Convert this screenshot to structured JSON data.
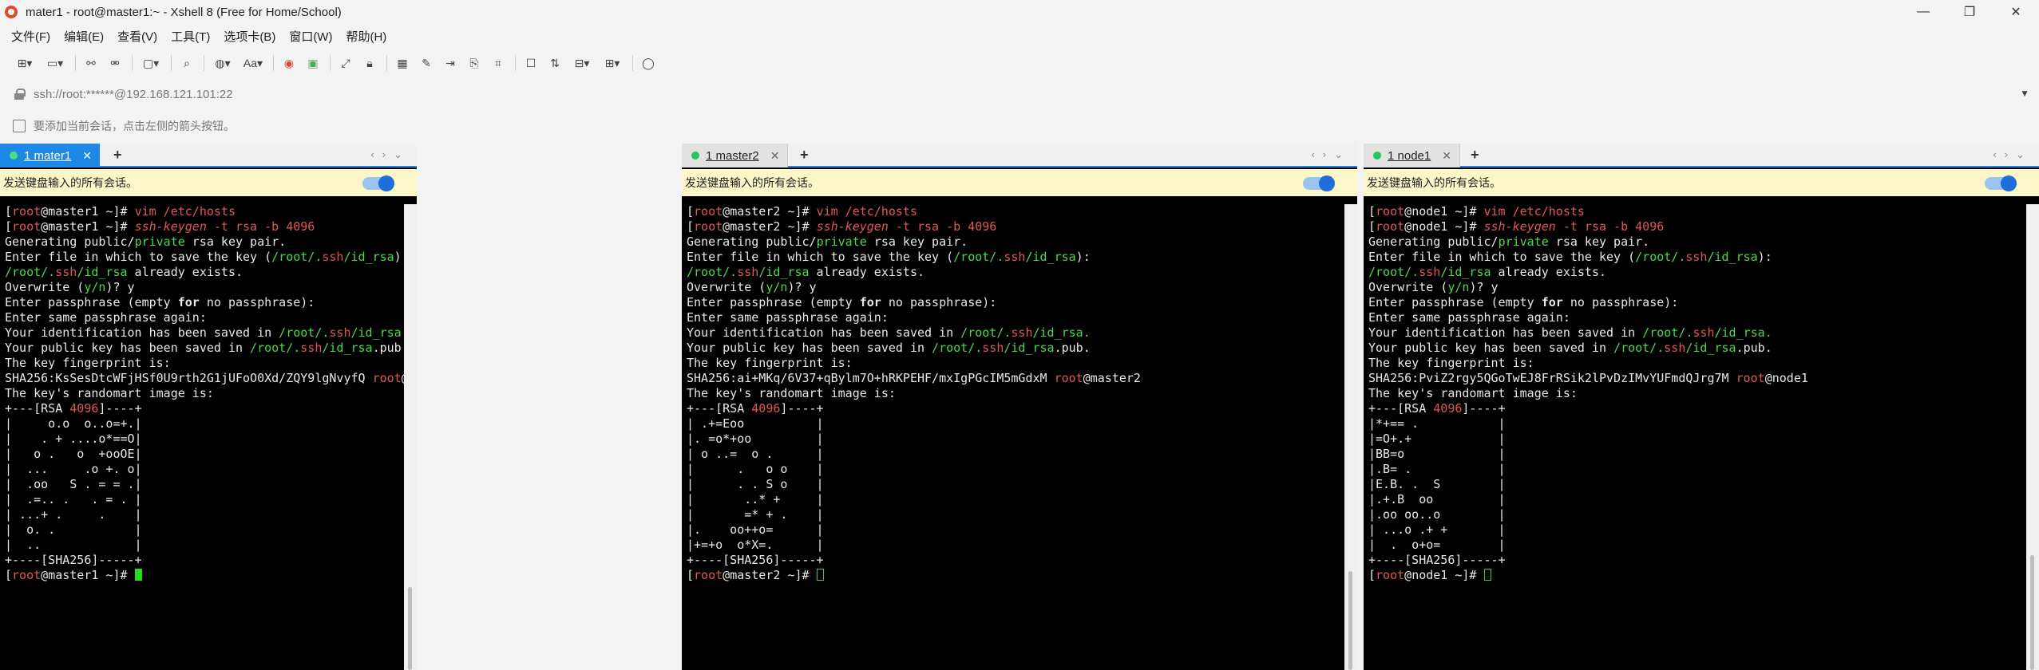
{
  "window": {
    "title": "mater1 - root@master1:~ - Xshell 8 (Free for Home/School)",
    "controls": [
      "—",
      "❐",
      "✕"
    ]
  },
  "menu": [
    "文件(F)",
    "编辑(E)",
    "查看(V)",
    "工具(T)",
    "选项卡(B)",
    "窗口(W)",
    "帮助(H)"
  ],
  "toolbar_icons": [
    "new-session-icon",
    "open-folder-icon",
    "connect-icon",
    "disconnect-icon",
    "new-tab-icon",
    "find-icon",
    "globe-icon",
    "font-icon",
    "xshell-icon",
    "xftp-icon",
    "fullscreen-icon",
    "lock-icon",
    "highlight-icon",
    "script-icon",
    "record-icon",
    "compose-icon",
    "compose-bar-icon",
    "log-icon",
    "transfer-icon",
    "layout-icon",
    "chat-icon"
  ],
  "address": {
    "value": "ssh://root:******@192.168.121.101:22"
  },
  "hint": {
    "text": "要添加当前会话，点击左侧的箭头按钮。"
  },
  "send_bar_text": "发送键盘输入的所有会话。",
  "panes": [
    {
      "tab_label": "1 mater1",
      "host": "master1",
      "fingerprint": "KsSesDtcWFjHSf0U9rth2G1jUFoO0Xd/ZQY9lgNvyfQ",
      "randomart": [
        "|     o.o  o..o=+.|",
        "|    . + ....o*==O|",
        "|   o .   o  +ooOE|",
        "|  ...     .o +. o|",
        "|  .oo   S . = = .|",
        "|  .=.. .   . = . |",
        "| ...+ .     .    |",
        "|  o. .           |",
        "|  ..             |"
      ]
    },
    {
      "tab_label": "1 master2",
      "host": "master2",
      "fingerprint": "ai+MKq/6V37+qBylm7O+hRKPEHF/mxIgPGcIM5mGdxM",
      "randomart": [
        "| .+=Eoo          |",
        "|. =o*+oo         |",
        "| o ..=  o .      |",
        "|      .   o o    |",
        "|      . . S o    |",
        "|       ..* +     |",
        "|       =* + .    |",
        "|.    oo++o=      |",
        "|+=+o  o*X=.      |"
      ]
    },
    {
      "tab_label": "1 node1",
      "host": "node1",
      "fingerprint": "PviZ2rgy5QGoTwEJ8FrRSik2lPvDzIMvYUFmdQJrg7M",
      "randomart": [
        "|*+== .           |",
        "|=O+.+            |",
        "|BB=o             |",
        "|.B= .            |",
        "|E.B. .  S        |",
        "|.+.B  oo         |",
        "|.oo oo..o        |",
        "| ...o .+ +       |",
        "|  .  o+o=        |"
      ]
    }
  ],
  "term_common": {
    "user": "root",
    "prompt_dir": "~]#",
    "cmd1": "vim /etc/hosts",
    "cmd2_name": "ssh-keygen",
    "cmd2_args": " -t rsa -b ",
    "cmd2_bits": "4096",
    "l_generating_a": "Generating public/",
    "l_generating_b": "private",
    "l_generating_c": " rsa key pair.",
    "l_enter_file_a": "Enter file in which to save the key (",
    "l_enter_file_b": "/root/.",
    "l_enter_file_c": "ssh",
    "l_enter_file_d": "/id_rsa",
    "l_enter_file_e": "):",
    "l_exists_a": "/root/.",
    "l_exists_b": "ssh",
    "l_exists_c": "/id_rsa",
    "l_exists_d": " already exists.",
    "l_overwrite_a": "Overwrite (",
    "l_overwrite_b": "y/n",
    "l_overwrite_c": ")? y",
    "l_pass_a": "Enter passphrase (empty ",
    "l_pass_b": "for",
    "l_pass_c": " no passphrase):",
    "l_same": "Enter same passphrase again:",
    "l_ident_a": "Your identification has been saved in ",
    "l_ident_b": "/root/.",
    "l_ident_c": "ssh",
    "l_ident_d": "/id_rsa.",
    "l_pub_a": "Your public key has been saved in ",
    "l_pub_b": "/root/.",
    "l_pub_c": "ssh",
    "l_pub_d": "/id_rsa",
    "l_pub_e": ".pub.",
    "l_fp": "The key fingerprint is:",
    "l_sha": "SHA256:",
    "l_art": "The key's randomart image is:",
    "art_top_a": "+---[RSA ",
    "art_top_b": "4096",
    "art_top_c": "]----+",
    "art_bottom": "+----[SHA256]-----+"
  }
}
